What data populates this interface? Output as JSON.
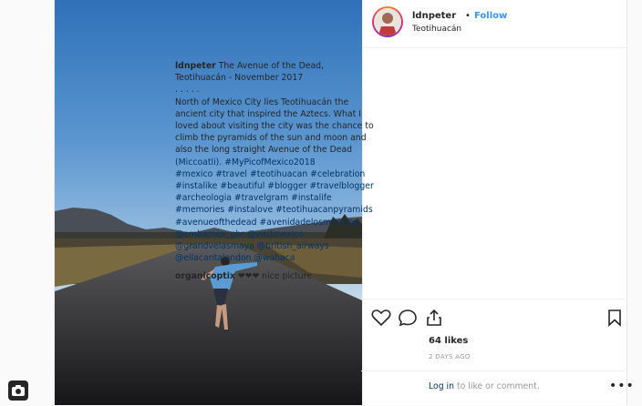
{
  "post": {
    "username": "ldnpeter",
    "dot": "•",
    "follow_label": "Follow",
    "location": "Teotihuacán",
    "caption_lines": [
      "The Avenue of the Dead,",
      "Teotihuacán - November 2017",
      ". . . . .",
      "North of Mexico City lies Teotihuacán the",
      "ancient city that inspired the Aztecs. What I",
      "loved about visiting the city was the chance to",
      "climb the pyramids of the sun and moon and",
      "also the long straight Avenue of the Dead",
      "(Miccoatli). #MyPicofMexico2018",
      "#mexico #travel #teotihuacan #celebration",
      "#instalike #beautiful #blogger #travelblogger",
      "#archeologia #travelgram #instalife",
      "#memories #instalove #teotihuacanpyramids",
      "#avenueofthedead #avenidadelosmuertos",
      "@embamex_gbr @visitmexico",
      "@grandvelasmaya @british_airways",
      "@ellacantalondon @wahaca"
    ],
    "comment": {
      "username": "organicoptix",
      "text": "❤❤❤ nice picture"
    },
    "likes": "64 likes",
    "time_ago": "2 DAYS AGO",
    "login_link": "Log in",
    "login_rest": " to like or comment.",
    "more_label": "•••"
  },
  "icons": [
    "heart-icon",
    "comment-icon",
    "share-icon",
    "bookmark-icon",
    "camera-icon"
  ]
}
